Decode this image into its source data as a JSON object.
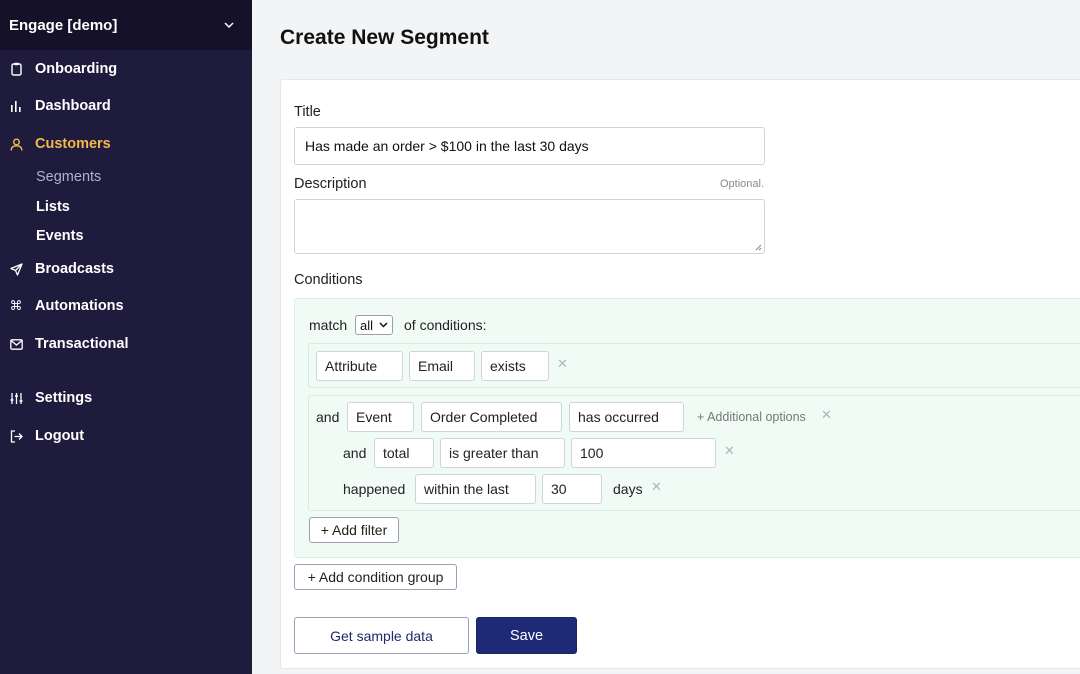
{
  "sidebar": {
    "workspace": "Engage [demo]",
    "items": [
      {
        "label": "Onboarding",
        "icon": "clipboard-icon"
      },
      {
        "label": "Dashboard",
        "icon": "bar-chart-icon"
      },
      {
        "label": "Customers",
        "icon": "user-icon",
        "active": true
      },
      {
        "label": "Broadcasts",
        "icon": "send-icon"
      },
      {
        "label": "Automations",
        "icon": "command-icon"
      },
      {
        "label": "Transactional",
        "icon": "mail-icon"
      },
      {
        "label": "Settings",
        "icon": "sliders-icon"
      },
      {
        "label": "Logout",
        "icon": "logout-icon"
      }
    ],
    "subitems": [
      {
        "label": "Segments",
        "current": true
      },
      {
        "label": "Lists"
      },
      {
        "label": "Events"
      }
    ]
  },
  "page": {
    "title": "Create New Segment"
  },
  "form": {
    "title_label": "Title",
    "title_value": "Has made an order > $100 in the last 30 days",
    "description_label": "Description",
    "optional_text": "Optional.",
    "description_value": "",
    "conditions_label": "Conditions"
  },
  "conditions": {
    "match_prefix": "match",
    "match_value": "all",
    "match_suffix": "of conditions:",
    "group1": {
      "type": "Attribute",
      "field": "Email",
      "operator": "exists"
    },
    "group2": {
      "and": "and",
      "type": "Event",
      "event": "Order Completed",
      "operator": "has occurred",
      "additional": "+ Additional options",
      "filter": {
        "and": "and",
        "field": "total",
        "operator": "is greater than",
        "value": "100"
      },
      "time": {
        "label": "happened",
        "operator": "within the last",
        "value": "30",
        "unit": "days"
      }
    },
    "add_filter": "+ Add filter",
    "add_group": "+ Add condition group"
  },
  "actions": {
    "sample": "Get sample data",
    "save": "Save"
  },
  "colors": {
    "sidebar": "#1f1b3d",
    "accent": "#f2b84b",
    "primary": "#1e2a78"
  }
}
